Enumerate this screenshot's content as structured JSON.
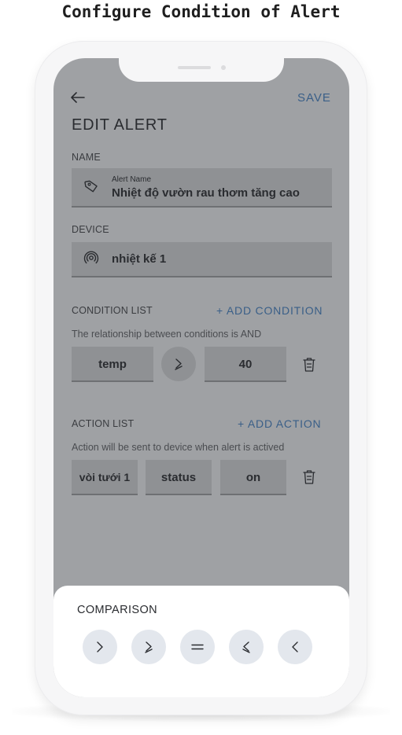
{
  "page_title": "Configure Condition of Alert",
  "header": {
    "save_label": "SAVE",
    "title": "EDIT ALERT"
  },
  "name_section": {
    "label": "NAME",
    "field_label": "Alert Name",
    "field_value": "Nhiệt độ vườn rau thơm tăng cao",
    "icon": "tag-icon"
  },
  "device_section": {
    "label": "DEVICE",
    "field_value": "nhiệt kế 1",
    "icon": "sensor-icon"
  },
  "condition_section": {
    "label": "CONDITION LIST",
    "add_label": "+ ADD CONDITION",
    "hint": "The relationship between conditions is AND",
    "condition": {
      "variable": "temp",
      "operator_icon": "greater-or-equal-icon",
      "value": "40"
    }
  },
  "action_section": {
    "label": "ACTION LIST",
    "add_label": "+ ADD ACTION",
    "hint": "Action will be sent to device when alert is actived",
    "action": {
      "device": "vòi tưới 1",
      "field": "status",
      "value": "on"
    }
  },
  "comparison_sheet": {
    "title": "COMPARISON",
    "operators": [
      "greater-than-icon",
      "greater-or-equal-icon",
      "equal-icon",
      "less-or-equal-icon",
      "less-than-icon"
    ]
  },
  "colors": {
    "accent": "#3a5f88",
    "overlay": "#9fa1a4",
    "sheet": "#ffffff",
    "operator_button": "#e3e7ed"
  }
}
